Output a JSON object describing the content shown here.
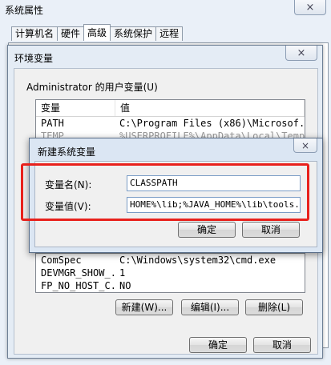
{
  "system_properties": {
    "title": "系统属性",
    "close_glyph": "×",
    "tabs": [
      "计算机名",
      "硬件",
      "高级",
      "系统保护",
      "远程"
    ],
    "active_tab": "高级"
  },
  "env_vars": {
    "title": "环境变量",
    "close_glyph": "×",
    "user_group_label": "Administrator 的用户变量(U)",
    "columns": [
      "变量",
      "值"
    ],
    "user_rows": [
      {
        "name": "PATH",
        "value": "C:\\Program Files (x86)\\Microsof..."
      },
      {
        "name": "TEMP",
        "value": "%USERPROFILE%\\AppData\\Local\\Temp"
      }
    ],
    "system_rows": [
      {
        "name": "ComSpec",
        "value": "C:\\Windows\\system32\\cmd.exe"
      },
      {
        "name": "DEVMGR_SHOW_...",
        "value": "1"
      },
      {
        "name": "FP_NO_HOST_C...",
        "value": "NO"
      }
    ],
    "buttons": {
      "new": "新建(W)...",
      "edit": "编辑(I)...",
      "delete": "删除(L)",
      "ok": "确定",
      "cancel": "取消"
    }
  },
  "new_variable": {
    "title": "新建系统变量",
    "close_glyph": "×",
    "name_label": "变量名(N):",
    "value_label": "变量值(V):",
    "name_value": "CLASSPATH",
    "value_value": "HOME%\\lib;%JAVA_HOME%\\lib\\tools.jar",
    "ok": "确定",
    "cancel": "取消"
  },
  "colors": {
    "highlight": "#e8211c"
  }
}
